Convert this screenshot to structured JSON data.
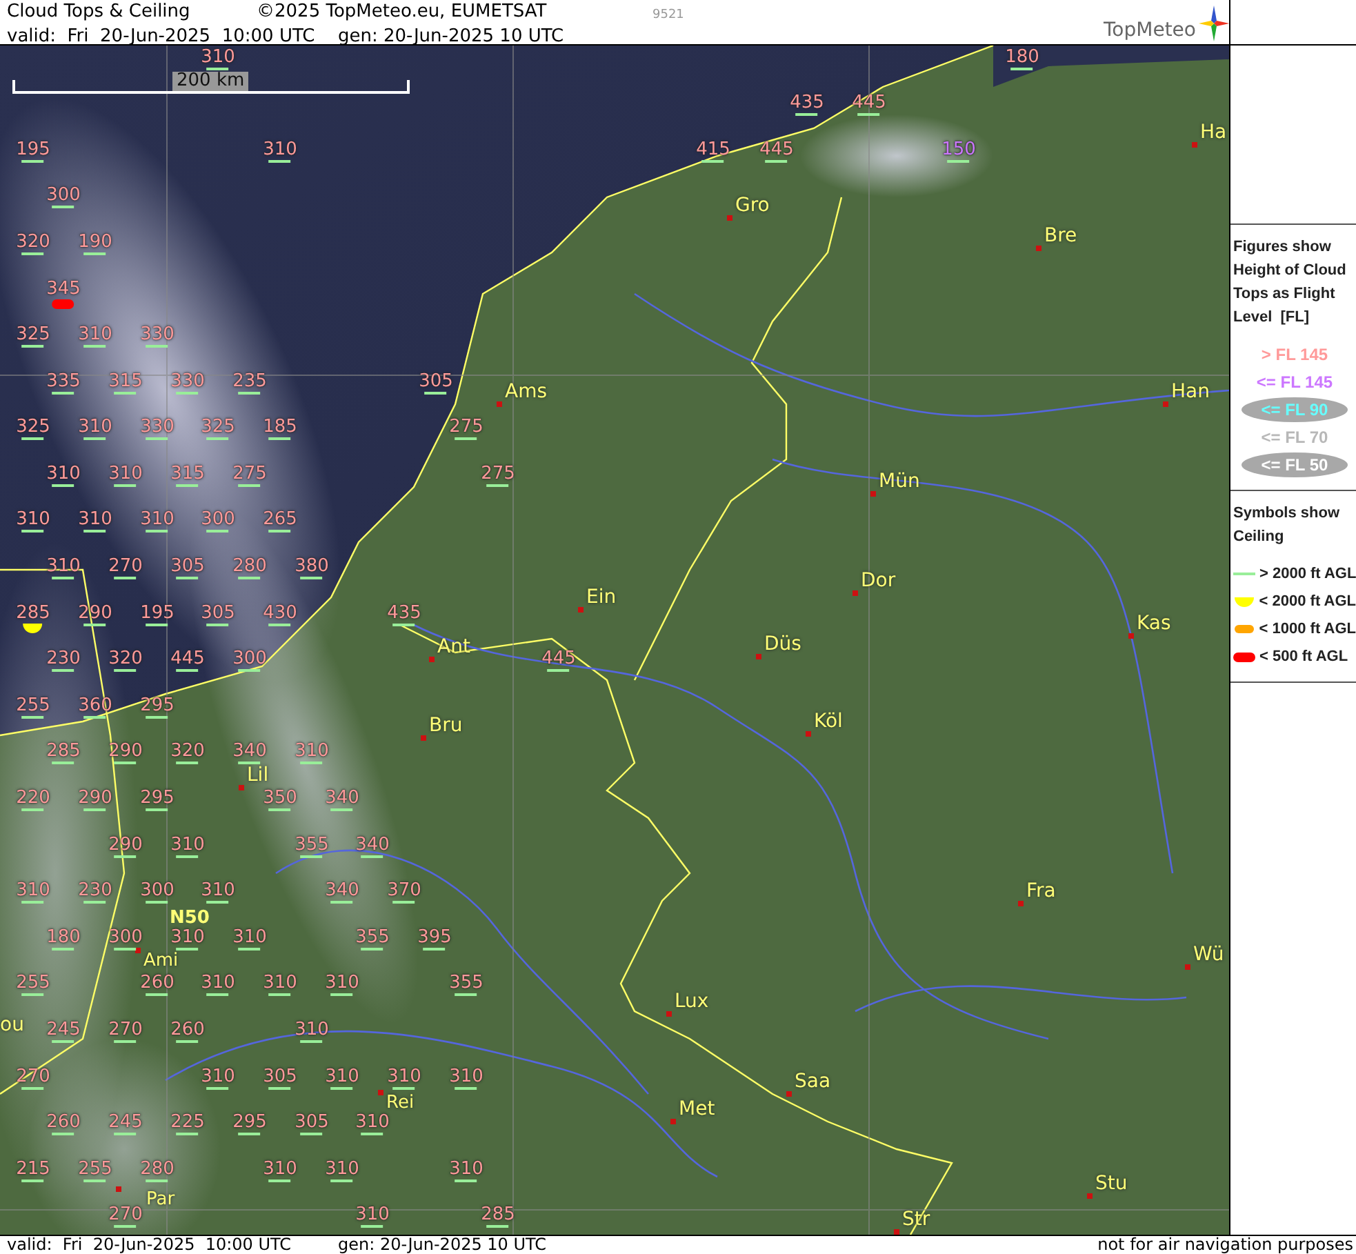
{
  "header": {
    "title": "Cloud Tops & Ceiling",
    "copyright": "©2025 TopMeteo.eu, EUMETSAT",
    "image_id": "9521",
    "valid": "valid:  Fri  20-Jun-2025  10:00 UTC",
    "generated": "gen: 20-Jun-2025 10 UTC"
  },
  "logo": {
    "text": "TopMeteo"
  },
  "map": {
    "scale_label": "200 km",
    "grid_label": "N50",
    "cities": [
      {
        "name": "Ha"
      },
      {
        "name": "Gro"
      },
      {
        "name": "Bre"
      },
      {
        "name": "Ams"
      },
      {
        "name": "Han"
      },
      {
        "name": "Mün"
      },
      {
        "name": "Dor"
      },
      {
        "name": "Ein"
      },
      {
        "name": "Düs"
      },
      {
        "name": "Ant"
      },
      {
        "name": "Kas"
      },
      {
        "name": "Bru"
      },
      {
        "name": "Köl"
      },
      {
        "name": "Lil"
      },
      {
        "name": "Fra"
      },
      {
        "name": "Ami"
      },
      {
        "name": "Wü"
      },
      {
        "name": "Lux"
      },
      {
        "name": "Rei"
      },
      {
        "name": "Saa"
      },
      {
        "name": "Met"
      },
      {
        "name": "Stu"
      },
      {
        "name": "Par"
      },
      {
        "name": "Str"
      },
      {
        "name": "ou"
      }
    ],
    "figures": [
      {
        "value": "310",
        "color": "#ff9a9a",
        "kind": "high"
      },
      {
        "value": "180",
        "color": "#ff9a9a",
        "kind": "high"
      },
      {
        "value": "435",
        "color": "#ff9a9a",
        "kind": "high"
      },
      {
        "value": "445",
        "color": "#ff9a9a",
        "kind": "high"
      },
      {
        "value": "195",
        "color": "#ff9a9a",
        "kind": "high"
      },
      {
        "value": "310",
        "color": "#ff9a9a",
        "kind": "high"
      },
      {
        "value": "415",
        "color": "#ff9a9a",
        "kind": "high"
      },
      {
        "value": "445",
        "color": "#ff9a9a",
        "kind": "high"
      },
      {
        "value": "150",
        "color": "#cc77ff",
        "kind": "high"
      },
      {
        "value": "300",
        "color": "#ff9a9a",
        "kind": "high"
      },
      {
        "value": "320",
        "color": "#ff9a9a",
        "kind": "high"
      },
      {
        "value": "190",
        "color": "#ff9a9a",
        "kind": "high"
      },
      {
        "value": "345",
        "color": "#ff9a9a",
        "kind": "lowest"
      },
      {
        "value": "325",
        "color": "#ff9a9a",
        "kind": "high"
      },
      {
        "value": "310",
        "color": "#ff9a9a",
        "kind": "high"
      },
      {
        "value": "330",
        "color": "#ff9a9a",
        "kind": "high"
      },
      {
        "value": "335",
        "color": "#ff9a9a",
        "kind": "high"
      },
      {
        "value": "315",
        "color": "#ff9a9a",
        "kind": "high"
      },
      {
        "value": "330",
        "color": "#ff9a9a",
        "kind": "high"
      },
      {
        "value": "235",
        "color": "#ff9a9a",
        "kind": "high"
      },
      {
        "value": "305",
        "color": "#ff9a9a",
        "kind": "high"
      },
      {
        "value": "325",
        "color": "#ff9a9a",
        "kind": "high"
      },
      {
        "value": "310",
        "color": "#ff9a9a",
        "kind": "high"
      },
      {
        "value": "330",
        "color": "#ff9a9a",
        "kind": "high"
      },
      {
        "value": "325",
        "color": "#ff9a9a",
        "kind": "high"
      },
      {
        "value": "185",
        "color": "#ff9a9a",
        "kind": "high"
      },
      {
        "value": "275",
        "color": "#ff9a9a",
        "kind": "high"
      },
      {
        "value": "310",
        "color": "#ff9a9a",
        "kind": "high"
      },
      {
        "value": "310",
        "color": "#ff9a9a",
        "kind": "high"
      },
      {
        "value": "315",
        "color": "#ff9a9a",
        "kind": "high"
      },
      {
        "value": "275",
        "color": "#ff9a9a",
        "kind": "high"
      },
      {
        "value": "275",
        "color": "#ff9a9a",
        "kind": "high"
      },
      {
        "value": "310",
        "color": "#ff9a9a",
        "kind": "high"
      },
      {
        "value": "310",
        "color": "#ff9a9a",
        "kind": "high"
      },
      {
        "value": "310",
        "color": "#ff9a9a",
        "kind": "high"
      },
      {
        "value": "300",
        "color": "#ff9a9a",
        "kind": "high"
      },
      {
        "value": "265",
        "color": "#ff9a9a",
        "kind": "high"
      },
      {
        "value": "310",
        "color": "#ff9a9a",
        "kind": "high"
      },
      {
        "value": "270",
        "color": "#ff9a9a",
        "kind": "high"
      },
      {
        "value": "305",
        "color": "#ff9a9a",
        "kind": "high"
      },
      {
        "value": "280",
        "color": "#ff9a9a",
        "kind": "high"
      },
      {
        "value": "380",
        "color": "#ff9a9a",
        "kind": "high"
      },
      {
        "value": "285",
        "color": "#ff9a9a",
        "kind": "low"
      },
      {
        "value": "290",
        "color": "#ff9a9a",
        "kind": "high"
      },
      {
        "value": "195",
        "color": "#ff9a9a",
        "kind": "high"
      },
      {
        "value": "305",
        "color": "#ff9a9a",
        "kind": "high"
      },
      {
        "value": "430",
        "color": "#ff9a9a",
        "kind": "high"
      },
      {
        "value": "435",
        "color": "#ff9a9a",
        "kind": "high"
      },
      {
        "value": "230",
        "color": "#ff9a9a",
        "kind": "high"
      },
      {
        "value": "320",
        "color": "#ff9a9a",
        "kind": "high"
      },
      {
        "value": "445",
        "color": "#ff9a9a",
        "kind": "high"
      },
      {
        "value": "300",
        "color": "#ff9a9a",
        "kind": "high"
      },
      {
        "value": "445",
        "color": "#ff9a9a",
        "kind": "high"
      },
      {
        "value": "255",
        "color": "#ff9a9a",
        "kind": "high"
      },
      {
        "value": "360",
        "color": "#ff9a9a",
        "kind": "high"
      },
      {
        "value": "295",
        "color": "#ff9a9a",
        "kind": "high"
      },
      {
        "value": "285",
        "color": "#ff9a9a",
        "kind": "high"
      },
      {
        "value": "290",
        "color": "#ff9a9a",
        "kind": "high"
      },
      {
        "value": "320",
        "color": "#ff9a9a",
        "kind": "high"
      },
      {
        "value": "340",
        "color": "#ff9a9a",
        "kind": "high"
      },
      {
        "value": "310",
        "color": "#ff9a9a",
        "kind": "high"
      },
      {
        "value": "220",
        "color": "#ff9a9a",
        "kind": "high"
      },
      {
        "value": "290",
        "color": "#ff9a9a",
        "kind": "high"
      },
      {
        "value": "295",
        "color": "#ff9a9a",
        "kind": "high"
      },
      {
        "value": "350",
        "color": "#ff9a9a",
        "kind": "high"
      },
      {
        "value": "340",
        "color": "#ff9a9a",
        "kind": "high"
      },
      {
        "value": "290",
        "color": "#ff9a9a",
        "kind": "high"
      },
      {
        "value": "310",
        "color": "#ff9a9a",
        "kind": "high"
      },
      {
        "value": "355",
        "color": "#ff9a9a",
        "kind": "high"
      },
      {
        "value": "340",
        "color": "#ff9a9a",
        "kind": "high"
      },
      {
        "value": "310",
        "color": "#ff9a9a",
        "kind": "high"
      },
      {
        "value": "230",
        "color": "#ff9a9a",
        "kind": "high"
      },
      {
        "value": "300",
        "color": "#ff9a9a",
        "kind": "high"
      },
      {
        "value": "310",
        "color": "#ff9a9a",
        "kind": "high"
      },
      {
        "value": "340",
        "color": "#ff9a9a",
        "kind": "high"
      },
      {
        "value": "370",
        "color": "#ff9a9a",
        "kind": "high"
      },
      {
        "value": "180",
        "color": "#ff9a9a",
        "kind": "high"
      },
      {
        "value": "300",
        "color": "#ff9a9a",
        "kind": "high"
      },
      {
        "value": "310",
        "color": "#ff9a9a",
        "kind": "high"
      },
      {
        "value": "310",
        "color": "#ff9a9a",
        "kind": "high"
      },
      {
        "value": "355",
        "color": "#ff9a9a",
        "kind": "high"
      },
      {
        "value": "395",
        "color": "#ff9a9a",
        "kind": "high"
      },
      {
        "value": "255",
        "color": "#ff9a9a",
        "kind": "high"
      },
      {
        "value": "260",
        "color": "#ff9a9a",
        "kind": "high"
      },
      {
        "value": "310",
        "color": "#ff9a9a",
        "kind": "high"
      },
      {
        "value": "310",
        "color": "#ff9a9a",
        "kind": "high"
      },
      {
        "value": "310",
        "color": "#ff9a9a",
        "kind": "high"
      },
      {
        "value": "355",
        "color": "#ff9a9a",
        "kind": "high"
      },
      {
        "value": "245",
        "color": "#ff9a9a",
        "kind": "high"
      },
      {
        "value": "270",
        "color": "#ff9a9a",
        "kind": "high"
      },
      {
        "value": "260",
        "color": "#ff9a9a",
        "kind": "high"
      },
      {
        "value": "310",
        "color": "#ff9a9a",
        "kind": "high"
      },
      {
        "value": "270",
        "color": "#ff9a9a",
        "kind": "high"
      },
      {
        "value": "310",
        "color": "#ff9a9a",
        "kind": "high"
      },
      {
        "value": "305",
        "color": "#ff9a9a",
        "kind": "high"
      },
      {
        "value": "310",
        "color": "#ff9a9a",
        "kind": "high"
      },
      {
        "value": "310",
        "color": "#ff9a9a",
        "kind": "high"
      },
      {
        "value": "310",
        "color": "#ff9a9a",
        "kind": "high"
      },
      {
        "value": "260",
        "color": "#ff9a9a",
        "kind": "high"
      },
      {
        "value": "245",
        "color": "#ff9a9a",
        "kind": "high"
      },
      {
        "value": "225",
        "color": "#ff9a9a",
        "kind": "high"
      },
      {
        "value": "295",
        "color": "#ff9a9a",
        "kind": "high"
      },
      {
        "value": "305",
        "color": "#ff9a9a",
        "kind": "high"
      },
      {
        "value": "310",
        "color": "#ff9a9a",
        "kind": "high"
      },
      {
        "value": "215",
        "color": "#ff9a9a",
        "kind": "high"
      },
      {
        "value": "255",
        "color": "#ff9a9a",
        "kind": "high"
      },
      {
        "value": "280",
        "color": "#ff9a9a",
        "kind": "high"
      },
      {
        "value": "310",
        "color": "#ff9a9a",
        "kind": "high"
      },
      {
        "value": "310",
        "color": "#ff9a9a",
        "kind": "high"
      },
      {
        "value": "310",
        "color": "#ff9a9a",
        "kind": "high"
      },
      {
        "value": "270",
        "color": "#ff9a9a",
        "kind": "high"
      },
      {
        "value": "310",
        "color": "#ff9a9a",
        "kind": "high"
      },
      {
        "value": "285",
        "color": "#ff9a9a",
        "kind": "high"
      }
    ]
  },
  "legend": {
    "figures_title": "Figures show Height of Cloud Tops as Flight Level  [FL]",
    "figure_levels": [
      {
        "label": "> FL 145",
        "color": "#ff9a9a",
        "kind": "plain"
      },
      {
        "label": "<= FL 145",
        "color": "#cc77ff",
        "kind": "plain"
      },
      {
        "label": "<= FL 90",
        "color": "#66ffff",
        "kind": "oval"
      },
      {
        "label": "<= FL 70",
        "color": "#b8b8b8",
        "kind": "plain"
      },
      {
        "label": "<= FL 50",
        "color": "#ffffff",
        "kind": "oval"
      }
    ],
    "symbols_title": "Symbols show Ceiling",
    "symbols": [
      {
        "label": "> 2000 ft AGL",
        "kind": "high"
      },
      {
        "label": "< 2000 ft AGL",
        "kind": "low"
      },
      {
        "label": "< 1000 ft AGL",
        "kind": "lower"
      },
      {
        "label": "< 500 ft AGL",
        "kind": "lowest"
      }
    ]
  },
  "footer": {
    "valid": "valid:  Fri  20-Jun-2025  10:00 UTC",
    "generated": "gen: 20-Jun-2025 10 UTC",
    "disclaimer": "not for air navigation purposes"
  }
}
